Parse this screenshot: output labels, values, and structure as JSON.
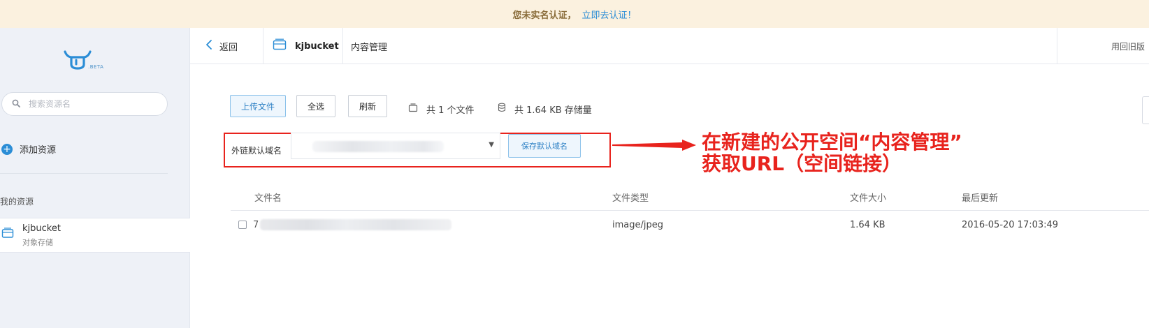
{
  "banner": {
    "warning": "您未实名认证，",
    "link": "立即去认证！"
  },
  "sidebar": {
    "logo_badge": ".BETA",
    "search": {
      "placeholder": "搜索资源名",
      "icon": "search-icon"
    },
    "add_resource": "添加资源",
    "section_title": "我的资源",
    "bucket": {
      "name": "kjbucket",
      "type": "对象存储",
      "icon": "bucket-icon"
    }
  },
  "header": {
    "back_label": "返回",
    "bucket_name": "kjbucket",
    "section": "内容管理",
    "old_version": "用回旧版"
  },
  "toolbar": {
    "upload_label": "上传文件",
    "select_all_label": "全选",
    "refresh_label": "刷新",
    "file_count": "共 1 个文件",
    "storage_used": "共 1.64 KB 存储量"
  },
  "domain": {
    "label": "外链默认域名",
    "save_label": "保存默认域名"
  },
  "annotation": {
    "line1": "在新建的公开空间“内容管理”",
    "line2": "获取URL（空间链接）",
    "color": "#e8231d"
  },
  "table": {
    "columns": [
      "文件名",
      "文件类型",
      "文件大小",
      "最后更新"
    ],
    "rows": [
      {
        "name_prefix": "7",
        "type": "image/jpeg",
        "size": "1.64 KB",
        "updated": "2016-05-20 17:03:49"
      }
    ]
  },
  "colors": {
    "accent": "#2b8dd6",
    "banner_bg": "#fbf1df",
    "sidebar_bg": "#eef1f7",
    "highlight_red": "#e8231d"
  }
}
